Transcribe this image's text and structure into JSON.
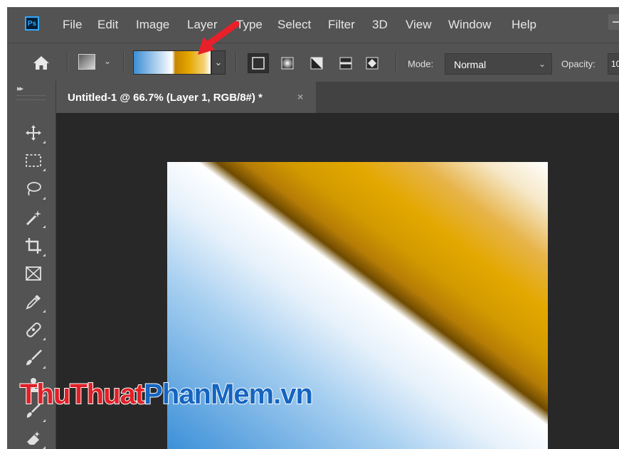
{
  "app": {
    "logo_text": "Ps",
    "menu": [
      "File",
      "Edit",
      "Image",
      "Layer",
      "Type",
      "Select",
      "Filter",
      "3D",
      "View",
      "Window",
      "Help"
    ]
  },
  "options_bar": {
    "home_icon": "home-icon",
    "gradient": {
      "description_colors": [
        "#3a8ed6",
        "#ffffff",
        "#c88500",
        "#e5a600",
        "#ffffff"
      ]
    },
    "gradient_styles": [
      {
        "name": "linear",
        "icon": "linear-gradient-icon",
        "active": true
      },
      {
        "name": "radial",
        "icon": "radial-gradient-icon",
        "active": false
      },
      {
        "name": "angle",
        "icon": "angle-gradient-icon",
        "active": false
      },
      {
        "name": "reflected",
        "icon": "reflected-gradient-icon",
        "active": false
      },
      {
        "name": "diamond",
        "icon": "diamond-gradient-icon",
        "active": false
      }
    ],
    "mode_label": "Mode:",
    "mode_value": "Normal",
    "opacity_label": "Opacity:",
    "opacity_value": "10"
  },
  "document": {
    "tab_title": "Untitled-1 @ 66.7% (Layer 1, RGB/8#) *",
    "close_glyph": "×"
  },
  "toolbar": {
    "tools": [
      "move-icon",
      "marquee-icon",
      "lasso-icon",
      "magic-wand-icon",
      "crop-icon",
      "frame-icon",
      "eyedropper-icon",
      "healing-brush-icon",
      "brush-icon",
      "clone-stamp-icon",
      "history-brush-icon",
      "eraser-icon"
    ]
  },
  "watermark": {
    "part1": "ThuThuat",
    "part2": "PhanMem.vn"
  },
  "colors": {
    "ui_background": "#535353",
    "canvas_background": "#282828",
    "annotation_arrow": "#e8202a",
    "watermark_red": "#e11f26",
    "watermark_blue": "#1565c0"
  }
}
